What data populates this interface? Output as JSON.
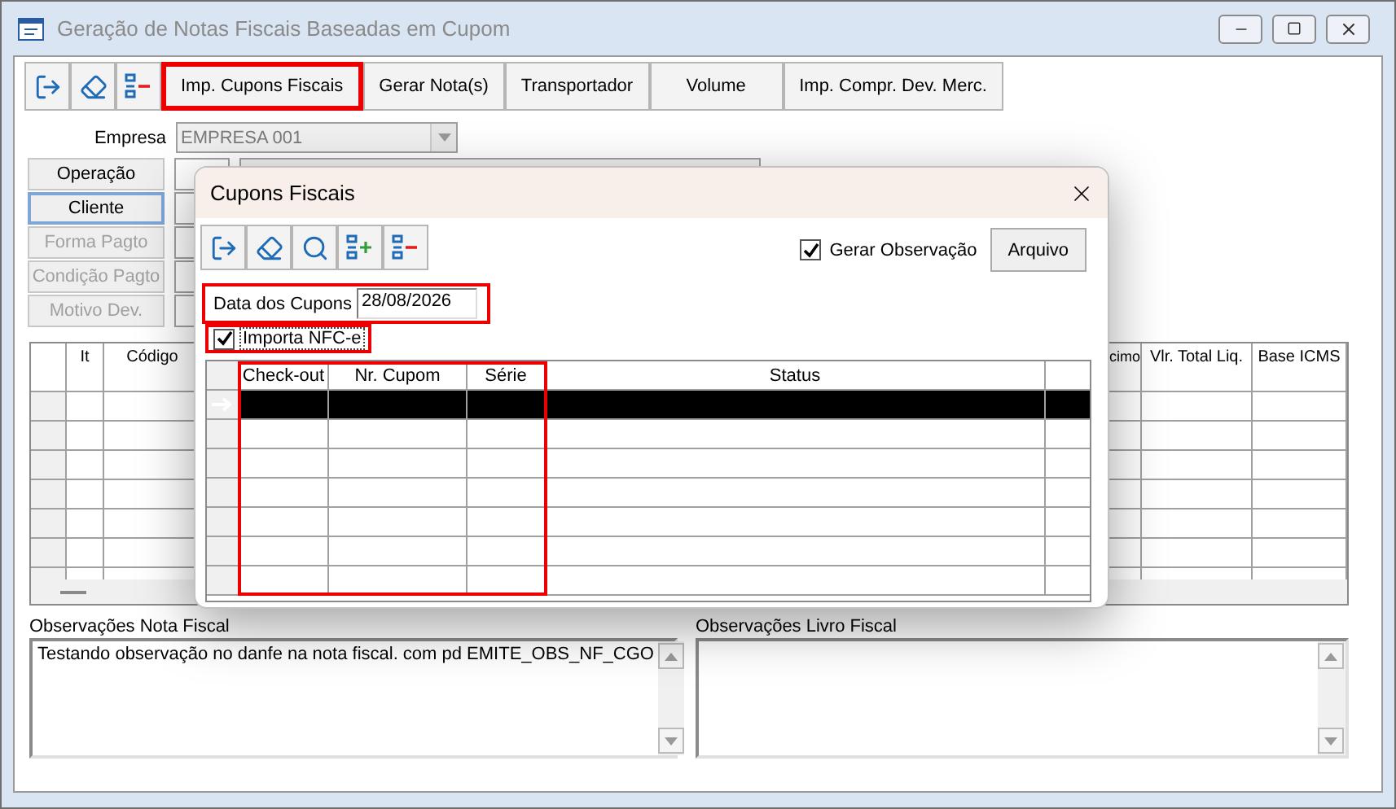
{
  "window": {
    "title": "Geração de Notas Fiscais Baseadas em Cupom"
  },
  "toolbar": {
    "buttons": [
      {
        "label": "Imp. Cupons Fiscais",
        "highlighted": true
      },
      {
        "label": "Gerar Nota(s)",
        "highlighted": false
      },
      {
        "label": "Transportador",
        "highlighted": false
      },
      {
        "label": "Volume",
        "highlighted": false
      },
      {
        "label": "Imp. Compr. Dev. Merc.",
        "highlighted": false
      }
    ]
  },
  "form": {
    "empresa": {
      "label": "Empresa",
      "value": "EMPRESA 001",
      "disabled": true
    },
    "buttons": [
      {
        "label": "Operação",
        "disabled": false,
        "focused": false
      },
      {
        "label": "Cliente",
        "disabled": false,
        "focused": true
      },
      {
        "label": "Forma Pagto",
        "disabled": true,
        "focused": false
      },
      {
        "label": "Condição Pagto",
        "disabled": true,
        "focused": false
      },
      {
        "label": "Motivo Dev.",
        "disabled": true,
        "focused": false
      }
    ]
  },
  "items_grid": {
    "columns": [
      "It",
      "Código",
      "cimo",
      "Vlr. Total Liq.",
      "Base ICMS"
    ]
  },
  "observations": [
    {
      "label": "Observações Nota Fiscal",
      "value": "Testando observação no danfe na nota fiscal. com pd EMITE_OBS_NF_CGO"
    },
    {
      "label": "Observações Livro Fiscal"
    }
  ],
  "dialog": {
    "title": "Cupons Fiscais",
    "gerar_observacao": {
      "label": "Gerar Observação",
      "checked": true
    },
    "arquivo_button": "Arquivo",
    "date": {
      "label": "Data dos Cupons",
      "value": "28/08/2026",
      "highlighted": true
    },
    "importa_nfce": {
      "label": "Importa NFC-e",
      "checked": true,
      "highlighted": true
    },
    "grid": {
      "columns": [
        {
          "label": "Check-out",
          "highlighted": true
        },
        {
          "label": "Nr. Cupom",
          "highlighted": true
        },
        {
          "label": "Série",
          "highlighted": true
        },
        {
          "label": "Status",
          "highlighted": false
        }
      ],
      "rows": [
        {
          "selected": true
        },
        {
          "selected": false
        },
        {
          "selected": false
        },
        {
          "selected": false
        },
        {
          "selected": false
        },
        {
          "selected": false
        },
        {
          "selected": false
        }
      ]
    }
  }
}
